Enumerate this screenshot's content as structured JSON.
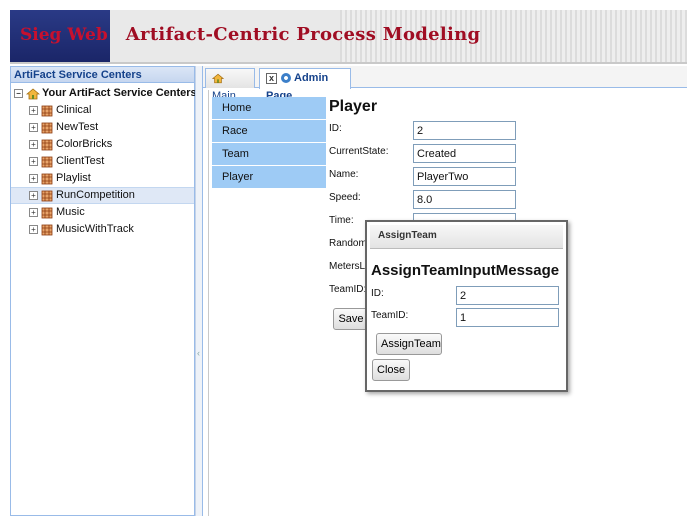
{
  "header": {
    "brand": "Sieg Web",
    "app_title": "Artifact-Centric Process Modeling"
  },
  "sidebar": {
    "title": "ArtiFact Service Centers",
    "root_label": "Your ArtiFact Service Centers",
    "items": [
      {
        "label": "Clinical"
      },
      {
        "label": "NewTest"
      },
      {
        "label": "ColorBricks"
      },
      {
        "label": "ClientTest"
      },
      {
        "label": "Playlist"
      },
      {
        "label": "RunCompetition",
        "selected": true
      },
      {
        "label": "Music"
      },
      {
        "label": "MusicWithTrack"
      }
    ]
  },
  "tabs": [
    {
      "label": "Main"
    },
    {
      "label": "Admin Page",
      "active": true
    }
  ],
  "nav": [
    "Home",
    "Race",
    "Team",
    "Player"
  ],
  "player_form": {
    "title": "Player",
    "fields": [
      {
        "label": "ID:",
        "value": "2"
      },
      {
        "label": "CurrentState:",
        "value": "Created"
      },
      {
        "label": "Name:",
        "value": "PlayerTwo"
      },
      {
        "label": "Speed:",
        "value": "8.0"
      },
      {
        "label": "Time:",
        "value": ""
      },
      {
        "label": "RandomI",
        "value": ""
      },
      {
        "label": "MetersLe",
        "value": ""
      },
      {
        "label": "TeamID:",
        "value": ""
      }
    ],
    "save_label": "Save"
  },
  "dialog": {
    "title": "AssignTeam",
    "heading": "AssignTeamInputMessage",
    "fields": [
      {
        "label": "ID:",
        "value": "2"
      },
      {
        "label": "TeamID:",
        "value": "1"
      }
    ],
    "assign_label": "AssignTeam",
    "close_label": "Close"
  }
}
